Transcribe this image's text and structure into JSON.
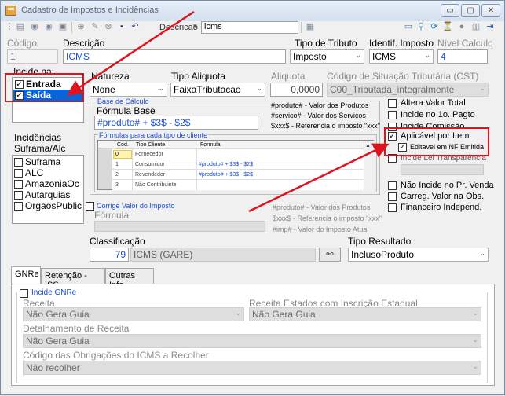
{
  "window": {
    "title": "Cadastro de Impostos e Incidências",
    "buttons": [
      "▭",
      "▢",
      "✕"
    ]
  },
  "toolbar": {
    "search_field_label": "Descricao",
    "search_value": "icms"
  },
  "header": {
    "codigo_label": "Código",
    "codigo_value": "1",
    "descricao_label": "Descrição",
    "descricao_value": "ICMS",
    "tipo_tributo_label": "Tipo de Tributo",
    "tipo_tributo_value": "Imposto",
    "identif_label": "Identif. Imposto",
    "identif_value": "ICMS",
    "nivel_label": "Nível Calculo",
    "nivel_value": "4"
  },
  "incide_na": {
    "label": "Incide na:",
    "items": [
      {
        "label": "Entrada",
        "checked": true
      },
      {
        "label": "Saída",
        "checked": true
      }
    ]
  },
  "incidencias": {
    "label_line1": "Incidências",
    "label_line2": "Suframa/Alc",
    "items": [
      "Suframa",
      "ALC",
      "AmazoniaOc",
      "Autarquias",
      "OrgaosPublic"
    ]
  },
  "natureza": {
    "label": "Natureza",
    "value": "None"
  },
  "tipo_aliquota": {
    "label": "Tipo Aliquota",
    "value": "FaixaTributacao"
  },
  "aliquota": {
    "label": "Aliquota",
    "value": "0,0000"
  },
  "cst": {
    "label": "Código de Situação Tributária (CST)",
    "value": "C00_Tributada_integralmente"
  },
  "base_calculo": {
    "group_label": "Base de Cálculo",
    "formula_label": "Fórmula Base",
    "formula_value": "#produto# + $3$ - $2$",
    "hints": [
      "#produto# - Valor dos Produtos",
      "#servico# - Valor dos Serviços",
      "$xxx$ - Referencia o imposto \"xxx\""
    ]
  },
  "formulas_grid": {
    "group_label": "Fórmulas para cada tipo de cliente",
    "columns": [
      "Cod.",
      "Tipo Cliente",
      "Formula"
    ],
    "rows": [
      {
        "cod": "0",
        "tipo": "Fornecedor",
        "formula": ""
      },
      {
        "cod": "1",
        "tipo": "Consumidor",
        "formula": "#produto# + $3$ - $2$"
      },
      {
        "cod": "2",
        "tipo": "Revendedor",
        "formula": "#produto# + $3$ - $2$"
      },
      {
        "cod": "3",
        "tipo": "Não Contribuinte",
        "formula": ""
      }
    ]
  },
  "corrige": {
    "label": "Corrige Valor do Imposto",
    "formula_label": "Fórmula",
    "hints": [
      "#produto# - Valor dos Produtos",
      "$xxx$ - Referencia o imposto \"xxx\"",
      "#imp# - Valor do Imposto Atual"
    ]
  },
  "options_right": {
    "items_top": [
      "Altera Valor Total",
      "Incide no 1o. Pagto",
      "Incide Comissão"
    ],
    "aplicavel": "Aplicável por Item",
    "editavel": "Editavel em NF Emitida",
    "lei_transparencia": "Incide Lei Transparência",
    "items_bottom": [
      "Não Incide no Pr. Venda",
      "Carreg. Valor na Obs.",
      "Financeiro Independ."
    ]
  },
  "classificacao": {
    "label": "Classificação",
    "code": "79",
    "value": "ICMS (GARE)"
  },
  "tipo_resultado": {
    "label": "Tipo Resultado",
    "value": "InclusoProduto"
  },
  "tabs": [
    "GNRe",
    "Retenção - ISS",
    "Outras Info."
  ],
  "gnre": {
    "incide_label": "Incide GNRe",
    "receita_label": "Receita",
    "receita_value": "Não Gera Guia",
    "receita_estados_label": "Receita Estados com Inscrição Estadual",
    "receita_estados_value": "Não Gera Guia",
    "detalhamento_label": "Detalhamento de Receita",
    "detalhamento_value": "Não Gera Guia",
    "codigo_obrig_label": "Código das Obrigações do ICMS a Recolher",
    "codigo_obrig_value": "Não recolher"
  },
  "colors": {
    "annotation_red": "#e0121d",
    "selection_blue": "#0a64d8"
  }
}
